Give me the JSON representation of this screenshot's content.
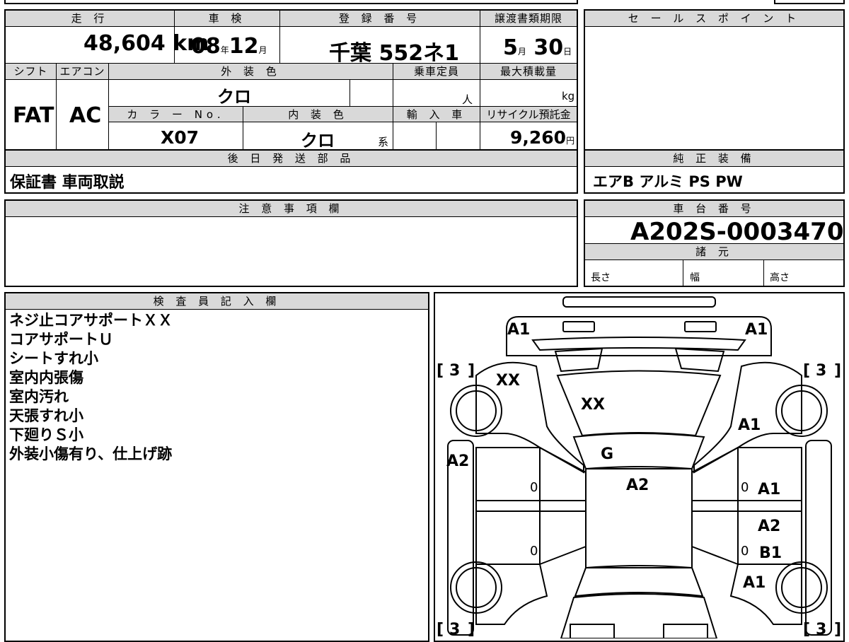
{
  "top_info": {
    "mileage": {
      "label": "走 行",
      "value": "48,604",
      "unit": "km"
    },
    "inspection": {
      "label": "車 検",
      "year": "08",
      "year_unit": "年",
      "month": "12",
      "month_unit": "月"
    },
    "registration": {
      "label": "登 録 番 号",
      "value": "千葉  552ネ1"
    },
    "transfer_deadline": {
      "label": "譲渡書類期限",
      "month": "5",
      "month_unit": "月",
      "day": "30",
      "day_unit": "日"
    },
    "shift": {
      "label": "シフト",
      "value": "FAT"
    },
    "aircon": {
      "label": "エアコン",
      "value": "AC"
    },
    "exterior_color": {
      "label": "外 装 色",
      "value": "クロ"
    },
    "capacity": {
      "label": "乗車定員",
      "unit": "人"
    },
    "max_load": {
      "label": "最大積載量",
      "unit": "kg"
    },
    "color_no": {
      "label": "カ ラ ー No.",
      "value": "X07"
    },
    "interior_color": {
      "label": "内 装 色",
      "value": "クロ",
      "suffix": "系"
    },
    "import": {
      "label": "輸 入 車"
    },
    "recycle_fee": {
      "label": "リサイクル預託金",
      "value": "9,260",
      "unit": "円"
    }
  },
  "sale_points": {
    "label": "セ ー ル ス ポ イ ン ト"
  },
  "later_parts": {
    "label": "後 日 発 送 部 品",
    "value": "保証書  車両取説"
  },
  "standard_equipment": {
    "label": "純 正 装 備",
    "value": "エアB  アルミ  PS  PW"
  },
  "notes": {
    "label": "注 意 事 項 欄"
  },
  "chassis": {
    "label": "車 台 番 号",
    "value": "A202S-0003470"
  },
  "specs": {
    "label": "諸 元",
    "length": "長さ",
    "width": "幅",
    "height": "高さ"
  },
  "inspector": {
    "label": "検 査 員 記 入 欄",
    "lines": [
      "ネジ止コアサポートＸＸ",
      "コアサポートＵ",
      "シートすれ小",
      "室内内張傷",
      "室内汚れ",
      "天張すれ小",
      "下廻りＳ小",
      "外装小傷有り、仕上げ跡"
    ]
  },
  "diagram": {
    "marks": {
      "front_left": "A1",
      "front_right": "A1",
      "hood": "XX",
      "fender_left": "XX",
      "fender_right": "A1",
      "windshield": "G",
      "roof": "A2",
      "side_left": "A2",
      "front_door_right": "A1",
      "rear_door_right": "A2",
      "rear_door_right_b": "B1",
      "rear_quarter_right": "A1"
    },
    "tire_tl": "3",
    "tire_tr": "3",
    "tire_bl": "3",
    "tire_br": "3",
    "zero": "0"
  }
}
